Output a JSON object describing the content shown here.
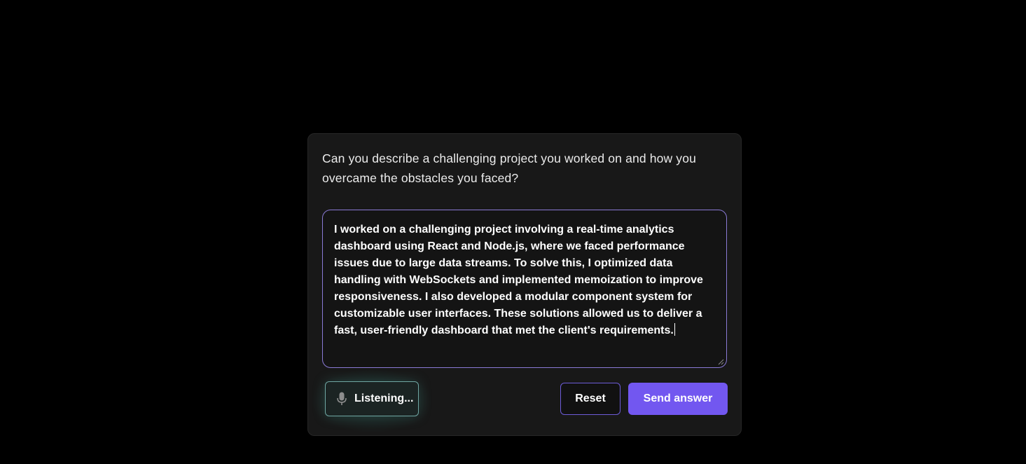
{
  "question": {
    "text": "Can you describe a challenging project you worked on and how you overcame the obstacles you faced?"
  },
  "answer": {
    "value": "I worked on a challenging project involving a real-time analytics dashboard using React and Node.js, where we faced performance issues due to large data streams. To solve this, I optimized data handling with WebSockets and implemented memoization to improve responsiveness. I also developed a modular component system for customizable user interfaces. These solutions allowed us to deliver a fast, user-friendly dashboard that met the client's requirements."
  },
  "controls": {
    "listening_label": "Listening...",
    "reset_label": "Reset",
    "send_label": "Send answer",
    "mic_icon": "microphone-icon"
  },
  "colors": {
    "accent": "#7257f0",
    "answer_border": "#8a7ad6",
    "listening_border": "#6fa6a2"
  }
}
